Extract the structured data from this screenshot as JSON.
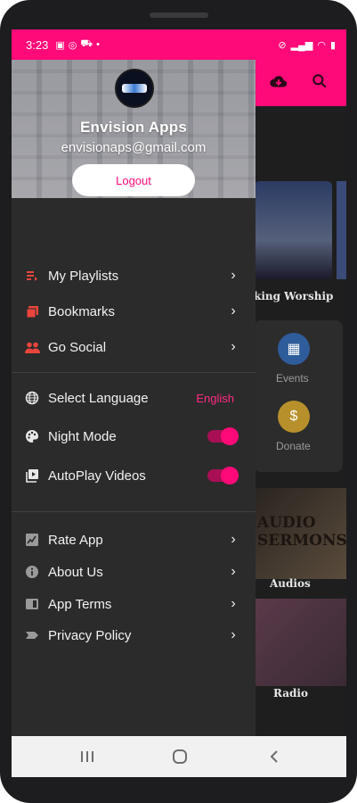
{
  "status_bar": {
    "time": "3:23",
    "left_icons": [
      "gallery-icon",
      "whatsapp-icon",
      "shop-icon",
      "dot-icon"
    ],
    "right_icons": [
      "mute-icon",
      "signal-icon",
      "signal-icon",
      "wifi-icon",
      "battery-icon"
    ]
  },
  "colors": {
    "accent": "#ff0a78",
    "drawer_bg": "#2b2b2b",
    "language_text": "#ff2a83"
  },
  "drawer": {
    "app_name": "Envision Apps",
    "email": "envisionaps@gmail.com",
    "logout_label": "Logout",
    "section1": [
      {
        "label": "My Playlists",
        "icon": "playlist-icon"
      },
      {
        "label": "Bookmarks",
        "icon": "bookmarks-icon"
      },
      {
        "label": "Go Social",
        "icon": "people-icon"
      }
    ],
    "section2": {
      "language_label": "Select Language",
      "language_value": "English",
      "night_mode_label": "Night Mode",
      "night_mode_on": true,
      "autoplay_label": "AutoPlay Videos",
      "autoplay_on": true
    },
    "section3": [
      {
        "label": "Rate App",
        "icon": "rate-icon"
      },
      {
        "label": "About Us",
        "icon": "info-icon"
      },
      {
        "label": "App Terms",
        "icon": "terms-icon"
      },
      {
        "label": "Privacy Policy",
        "icon": "privacy-icon"
      }
    ]
  },
  "background": {
    "video_title": "king Worship",
    "events_label": "Events",
    "donate_label": "Donate",
    "audio_card_title": "Audios",
    "audio_image_text_1": "AUDIO",
    "audio_image_text_2": "SERMONS",
    "radio_label": "Radio"
  },
  "navbar": {
    "buttons": [
      "recents-icon",
      "home-icon",
      "back-icon"
    ]
  }
}
